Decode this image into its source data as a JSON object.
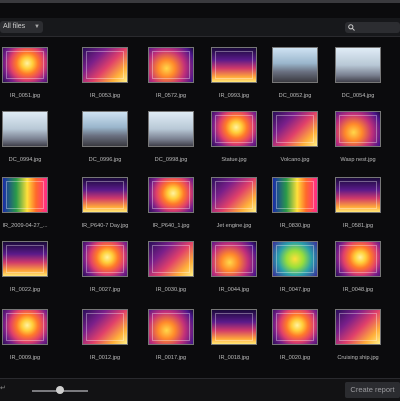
{
  "toolbar": {
    "filter_label": "All files",
    "search_placeholder": ""
  },
  "grid": {
    "rows": [
      [
        {
          "name": "IR_0051.jpg",
          "palette": "thermal"
        },
        {
          "name": "IR_0053.jpg",
          "palette": "thermal"
        },
        {
          "name": "IR_0572.jpg",
          "palette": "thermal"
        },
        {
          "name": "IR_0993.jpg",
          "palette": "thermal"
        },
        {
          "name": "DC_0052.jpg",
          "palette": "photo"
        },
        {
          "name": "DC_0054.jpg",
          "palette": "photo"
        }
      ],
      [
        {
          "name": "DC_0994.jpg",
          "palette": "photo"
        },
        {
          "name": "DC_0996.jpg",
          "palette": "photo"
        },
        {
          "name": "DC_0998.jpg",
          "palette": "photo"
        },
        {
          "name": "Statue.jpg",
          "palette": "thermal"
        },
        {
          "name": "Volcano.jpg",
          "palette": "thermal"
        },
        {
          "name": "Wasp nest.jpg",
          "palette": "thermal"
        }
      ],
      [
        {
          "name": "IR_2009-04-27_...",
          "palette": "rainbow"
        },
        {
          "name": "IR_P640-7 Day.jpg",
          "palette": "thermal"
        },
        {
          "name": "IR_P640_1.jpg",
          "palette": "thermal"
        },
        {
          "name": "Jet engine.jpg",
          "palette": "thermal"
        },
        {
          "name": "IR_0830.jpg",
          "palette": "rainbow"
        },
        {
          "name": "IR_0581.jpg",
          "palette": "thermal"
        }
      ],
      [
        {
          "name": "IR_0022.jpg",
          "palette": "thermal"
        },
        {
          "name": "IR_0027.jpg",
          "palette": "thermal"
        },
        {
          "name": "IR_0030.jpg",
          "palette": "thermal"
        },
        {
          "name": "IR_0044.jpg",
          "palette": "thermal"
        },
        {
          "name": "IR_0047.jpg",
          "palette": "rainbow"
        },
        {
          "name": "IR_0048.jpg",
          "palette": "thermal"
        }
      ],
      [
        {
          "name": "IR_0009.jpg",
          "palette": "thermal"
        },
        {
          "name": "IR_0012.jpg",
          "palette": "thermal"
        },
        {
          "name": "IR_0017.jpg",
          "palette": "thermal"
        },
        {
          "name": "IR_0018.jpg",
          "palette": "thermal"
        },
        {
          "name": "IR_0020.jpg",
          "palette": "thermal"
        },
        {
          "name": "Cruising ship.jpg",
          "palette": "thermal"
        }
      ]
    ]
  },
  "bottombar": {
    "create_report_label": "Create report",
    "zoom_level": 0.5
  },
  "colors": {
    "background": "#0b0b0d",
    "thermal_hot": "#ffcf3a",
    "thermal_mid": "#e0406a",
    "thermal_cold": "#3a1a8a"
  }
}
